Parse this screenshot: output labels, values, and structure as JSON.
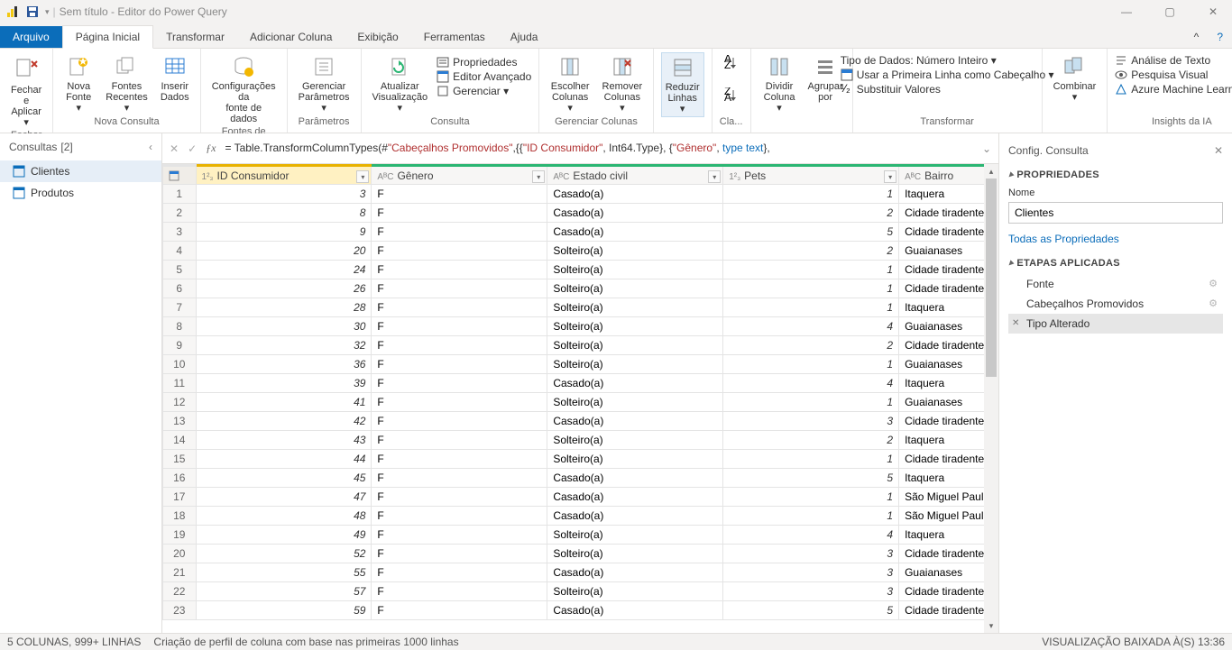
{
  "window": {
    "title": "Sem título - Editor do Power Query"
  },
  "menutabs": {
    "file": "Arquivo",
    "home": "Página Inicial",
    "transform": "Transformar",
    "addcol": "Adicionar Coluna",
    "view": "Exibição",
    "tools": "Ferramentas",
    "help": "Ajuda"
  },
  "ribbon": {
    "close": {
      "btn": "Fechar e\nAplicar ▾",
      "group": "Fechar"
    },
    "newquery": {
      "nova": "Nova\nFonte ▾",
      "recentes": "Fontes\nRecentes ▾",
      "inserir": "Inserir\nDados",
      "group": "Nova Consulta"
    },
    "datasrc": {
      "cfg": "Configurações da\nfonte de dados",
      "group": "Fontes de Dados"
    },
    "params": {
      "btn": "Gerenciar\nParâmetros ▾",
      "group": "Parâmetros"
    },
    "query": {
      "refresh": "Atualizar\nVisualização ▾",
      "props": "Propriedades",
      "adv": "Editor Avançado",
      "manage": "Gerenciar ▾",
      "group": "Consulta"
    },
    "cols": {
      "choose": "Escolher\nColunas ▾",
      "remove": "Remover\nColunas ▾",
      "group": "Gerenciar Colunas"
    },
    "rows": {
      "reduce": "Reduzir\nLinhas ▾"
    },
    "sort": {
      "group": "Cla..."
    },
    "split": {
      "split": "Dividir\nColuna ▾",
      "groupby": "Agrupar\npor"
    },
    "transform": {
      "datatype": "Tipo de Dados: Número Inteiro ▾",
      "firstrow": "Usar a Primeira Linha como Cabeçalho ▾",
      "replace": "Substituir Valores",
      "group": "Transformar"
    },
    "combine": {
      "btn": "Combinar\n▾"
    },
    "ia": {
      "text": "Análise de Texto",
      "vision": "Pesquisa Visual",
      "ml": "Azure Machine Learning",
      "group": "Insights da IA"
    }
  },
  "queries": {
    "title": "Consultas",
    "count": "[2]",
    "items": [
      "Clientes",
      "Produtos"
    ]
  },
  "formula": {
    "prefix": "= Table.TransformColumnTypes(#",
    "s1": "\"Cabeçalhos Promovidos\"",
    "mid1": ",{{",
    "s2": "\"ID Consumidor\"",
    "mid2": ", Int64.Type}, {",
    "s3": "\"Gênero\"",
    "mid3": ", ",
    "kw": "type text",
    "end": "},"
  },
  "columns": [
    {
      "type": "1²₃",
      "label": "ID Consumidor"
    },
    {
      "type": "AᴮC",
      "label": "Gênero"
    },
    {
      "type": "AᴮC",
      "label": "Estado civil"
    },
    {
      "type": "1²₃",
      "label": "Pets"
    },
    {
      "type": "AᴮC",
      "label": "Bairro"
    }
  ],
  "rows": [
    {
      "n": 1,
      "id": 3,
      "g": "F",
      "ec": "Casado(a)",
      "p": 1,
      "b": "Itaquera"
    },
    {
      "n": 2,
      "id": 8,
      "g": "F",
      "ec": "Casado(a)",
      "p": 2,
      "b": "Cidade tiradentes"
    },
    {
      "n": 3,
      "id": 9,
      "g": "F",
      "ec": "Casado(a)",
      "p": 5,
      "b": "Cidade tiradentes"
    },
    {
      "n": 4,
      "id": 20,
      "g": "F",
      "ec": "Solteiro(a)",
      "p": 2,
      "b": "Guaianases"
    },
    {
      "n": 5,
      "id": 24,
      "g": "F",
      "ec": "Solteiro(a)",
      "p": 1,
      "b": "Cidade tiradentes"
    },
    {
      "n": 6,
      "id": 26,
      "g": "F",
      "ec": "Solteiro(a)",
      "p": 1,
      "b": "Cidade tiradentes"
    },
    {
      "n": 7,
      "id": 28,
      "g": "F",
      "ec": "Solteiro(a)",
      "p": 1,
      "b": "Itaquera"
    },
    {
      "n": 8,
      "id": 30,
      "g": "F",
      "ec": "Solteiro(a)",
      "p": 4,
      "b": "Guaianases"
    },
    {
      "n": 9,
      "id": 32,
      "g": "F",
      "ec": "Solteiro(a)",
      "p": 2,
      "b": "Cidade tiradentes"
    },
    {
      "n": 10,
      "id": 36,
      "g": "F",
      "ec": "Solteiro(a)",
      "p": 1,
      "b": "Guaianases"
    },
    {
      "n": 11,
      "id": 39,
      "g": "F",
      "ec": "Casado(a)",
      "p": 4,
      "b": "Itaquera"
    },
    {
      "n": 12,
      "id": 41,
      "g": "F",
      "ec": "Solteiro(a)",
      "p": 1,
      "b": "Guaianases"
    },
    {
      "n": 13,
      "id": 42,
      "g": "F",
      "ec": "Casado(a)",
      "p": 3,
      "b": "Cidade tiradentes"
    },
    {
      "n": 14,
      "id": 43,
      "g": "F",
      "ec": "Solteiro(a)",
      "p": 2,
      "b": "Itaquera"
    },
    {
      "n": 15,
      "id": 44,
      "g": "F",
      "ec": "Solteiro(a)",
      "p": 1,
      "b": "Cidade tiradentes"
    },
    {
      "n": 16,
      "id": 45,
      "g": "F",
      "ec": "Casado(a)",
      "p": 5,
      "b": "Itaquera"
    },
    {
      "n": 17,
      "id": 47,
      "g": "F",
      "ec": "Casado(a)",
      "p": 1,
      "b": "São Miguel Paulista"
    },
    {
      "n": 18,
      "id": 48,
      "g": "F",
      "ec": "Casado(a)",
      "p": 1,
      "b": "São Miguel Paulista"
    },
    {
      "n": 19,
      "id": 49,
      "g": "F",
      "ec": "Solteiro(a)",
      "p": 4,
      "b": "Itaquera"
    },
    {
      "n": 20,
      "id": 52,
      "g": "F",
      "ec": "Solteiro(a)",
      "p": 3,
      "b": "Cidade tiradentes"
    },
    {
      "n": 21,
      "id": 55,
      "g": "F",
      "ec": "Casado(a)",
      "p": 3,
      "b": "Guaianases"
    },
    {
      "n": 22,
      "id": 57,
      "g": "F",
      "ec": "Solteiro(a)",
      "p": 3,
      "b": "Cidade tiradentes"
    },
    {
      "n": 23,
      "id": 59,
      "g": "F",
      "ec": "Casado(a)",
      "p": 5,
      "b": "Cidade tiradentes"
    }
  ],
  "settings": {
    "title": "Config. Consulta",
    "propsTitle": "PROPRIEDADES",
    "nameLabel": "Nome",
    "nameValue": "Clientes",
    "allProps": "Todas as Propriedades",
    "stepsTitle": "ETAPAS APLICADAS",
    "steps": [
      "Fonte",
      "Cabeçalhos Promovidos",
      "Tipo Alterado"
    ]
  },
  "status": {
    "left1": "5 COLUNAS, 999+ LINHAS",
    "left2": "Criação de perfil de coluna com base nas primeiras 1000 linhas",
    "right": "VISUALIZAÇÃO BAIXADA À(S) 13:36"
  }
}
